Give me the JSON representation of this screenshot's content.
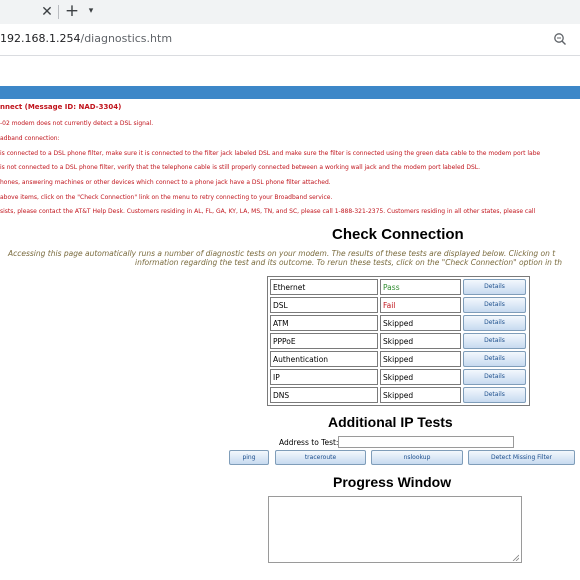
{
  "browser": {
    "url_host": "192.168.1.254",
    "url_path": "/diagnostics.htm",
    "icons": [
      "close-icon",
      "plus-icon",
      "chevron-down-icon",
      "zoom-icon"
    ]
  },
  "error": {
    "title": "nnect (Message ID: NAD-3304)",
    "lines": [
      "-02 modem does not currently detect a DSL signal.",
      "adband connection:",
      "is connected to a DSL phone filter, make sure it is connected to the filter jack labeled DSL and make sure the filter is connected using the green data cable to the modem port labe",
      "is not connected to a DSL phone filter, verify that the telephone cable is still properly connected between a working wall jack and the modem port labeled DSL.",
      "hones, answering machines or other devices which connect to a phone jack have a DSL phone filter attached.",
      "above items, click on the \"Check Connection\" link on the menu to retry connecting to your Broadband service.",
      "sists, please contact the AT&T Help Desk. Customers residing in AL, FL, GA, KY, LA, MS, TN, and SC, please call 1-888-321-2375. Customers residing in all other states, please call"
    ]
  },
  "check_connection": {
    "title": "Check Connection",
    "desc_line1": "Accessing this page automatically runs a number of diagnostic tests on your modem. The results of these tests are displayed below. Clicking on t",
    "desc_line2": "information regarding the test and its outcome. To rerun these tests, click on the \"Check Connection\" option in th",
    "details_label": "Details",
    "tests": [
      {
        "name": "Ethernet",
        "result": "Pass",
        "status": "pass"
      },
      {
        "name": "DSL",
        "result": "Fail",
        "status": "fail"
      },
      {
        "name": "ATM",
        "result": "Skipped",
        "status": "skip"
      },
      {
        "name": "PPPoE",
        "result": "Skipped",
        "status": "skip"
      },
      {
        "name": "Authentication",
        "result": "Skipped",
        "status": "skip"
      },
      {
        "name": "IP",
        "result": "Skipped",
        "status": "skip"
      },
      {
        "name": "DNS",
        "result": "Skipped",
        "status": "skip"
      }
    ],
    "colors": {
      "pass": "#2e8b2e",
      "fail": "#c0141c"
    }
  },
  "ip_tests": {
    "title": "Additional IP Tests",
    "address_label": "Address to Test:",
    "address_value": "",
    "buttons": {
      "ping": "ping",
      "traceroute": "traceroute",
      "nslookup": "nslookup",
      "detect": "Detect Missing Filter"
    }
  },
  "progress": {
    "title": "Progress Window",
    "content": ""
  }
}
